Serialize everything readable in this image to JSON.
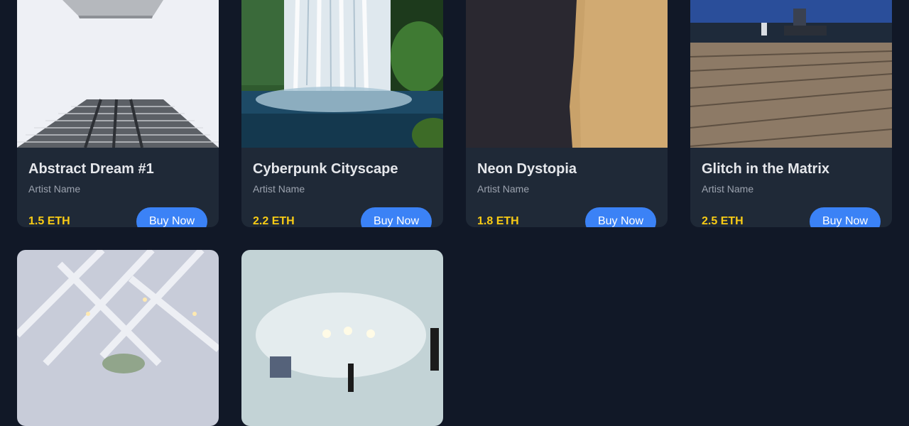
{
  "cards": [
    {
      "title": "Abstract Dream #1",
      "artist": "Artist Name",
      "price": "1.5 ETH",
      "button": "Buy Now",
      "image": "skyscraper-image"
    },
    {
      "title": "Cyberpunk Cityscape",
      "artist": "Artist Name",
      "price": "2.2 ETH",
      "button": "Buy Now",
      "image": "waterfall-image"
    },
    {
      "title": "Neon Dystopia",
      "artist": "Artist Name",
      "price": "1.8 ETH",
      "button": "Buy Now",
      "image": "asphalt-sand-image"
    },
    {
      "title": "Glitch in the Matrix",
      "artist": "Artist Name",
      "price": "2.5 ETH",
      "button": "Buy Now",
      "image": "boardwalk-image"
    },
    {
      "image": "light-beams-image"
    },
    {
      "image": "concert-image"
    }
  ],
  "colors": {
    "background": "#111827",
    "card": "#1f2937",
    "price": "#facc15",
    "button": "#3b82f6"
  }
}
